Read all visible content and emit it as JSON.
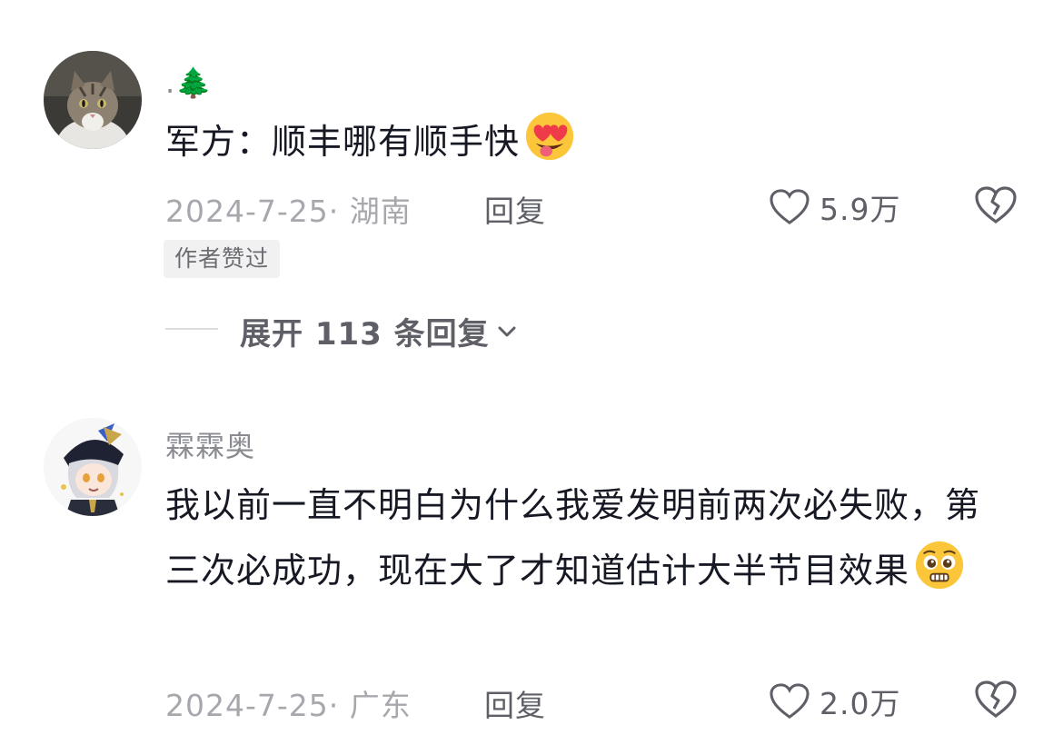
{
  "comments": [
    {
      "username": ".🌲",
      "avatar_icon": "cat-avatar-icon",
      "text": "军方：顺丰哪有顺手快",
      "trailing_emoji": "heart-eyes-tongue-emoji-icon",
      "date": "2024-7-25",
      "location": "湖南",
      "reply_label": "回复",
      "like_count": "5.9万",
      "badge": "作者赞过",
      "expand_label": "展开 113 条回复"
    },
    {
      "username": "霖霖奥",
      "avatar_icon": "anime-character-avatar-icon",
      "text": "我以前一直不明白为什么我爱发明前两次必失败，第三次必成功，现在大了才知道估计大半节目效果",
      "trailing_emoji": "pleading-face-emoji-icon",
      "date": "2024-7-25",
      "location": "广东",
      "reply_label": "回复",
      "like_count": "2.0万"
    }
  ],
  "colors": {
    "text_primary": "#161823",
    "text_secondary": "#a7a8ad",
    "icon_gray": "#5f6067"
  }
}
